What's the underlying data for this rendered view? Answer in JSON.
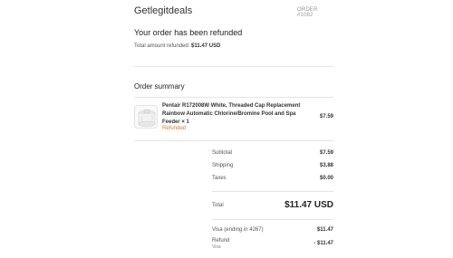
{
  "header": {
    "shop_name": "Getlegitdeals",
    "order_number": "ORDER #1082"
  },
  "refund": {
    "title": "Your order has been refunded",
    "amount_label": "Total amount refunded:",
    "amount_value": "$11.47 USD"
  },
  "summary": {
    "title": "Order summary",
    "item": {
      "image": "product-thumbnail",
      "title": "Pentair R172008W White, Threaded Cap Replacement Rainbow Automatic Chlorine/Bromine Pool and Spa Feeder × 1",
      "status": "Refunded",
      "status_color": "#e07a2b",
      "price": "$7.59"
    },
    "lines": [
      {
        "label": "Subtotal",
        "value": "$7.59"
      },
      {
        "label": "Shipping",
        "value": "$3.88"
      },
      {
        "label": "Taxes",
        "value": "$0.00"
      }
    ],
    "total": {
      "label": "Total",
      "value": "$11.47 USD"
    },
    "payments": [
      {
        "label": "Visa (ending in 4267)",
        "value": "$11.47"
      }
    ],
    "refund_line": {
      "label": "Refund",
      "sublabel": "Visa",
      "value": "- $11.47"
    }
  }
}
